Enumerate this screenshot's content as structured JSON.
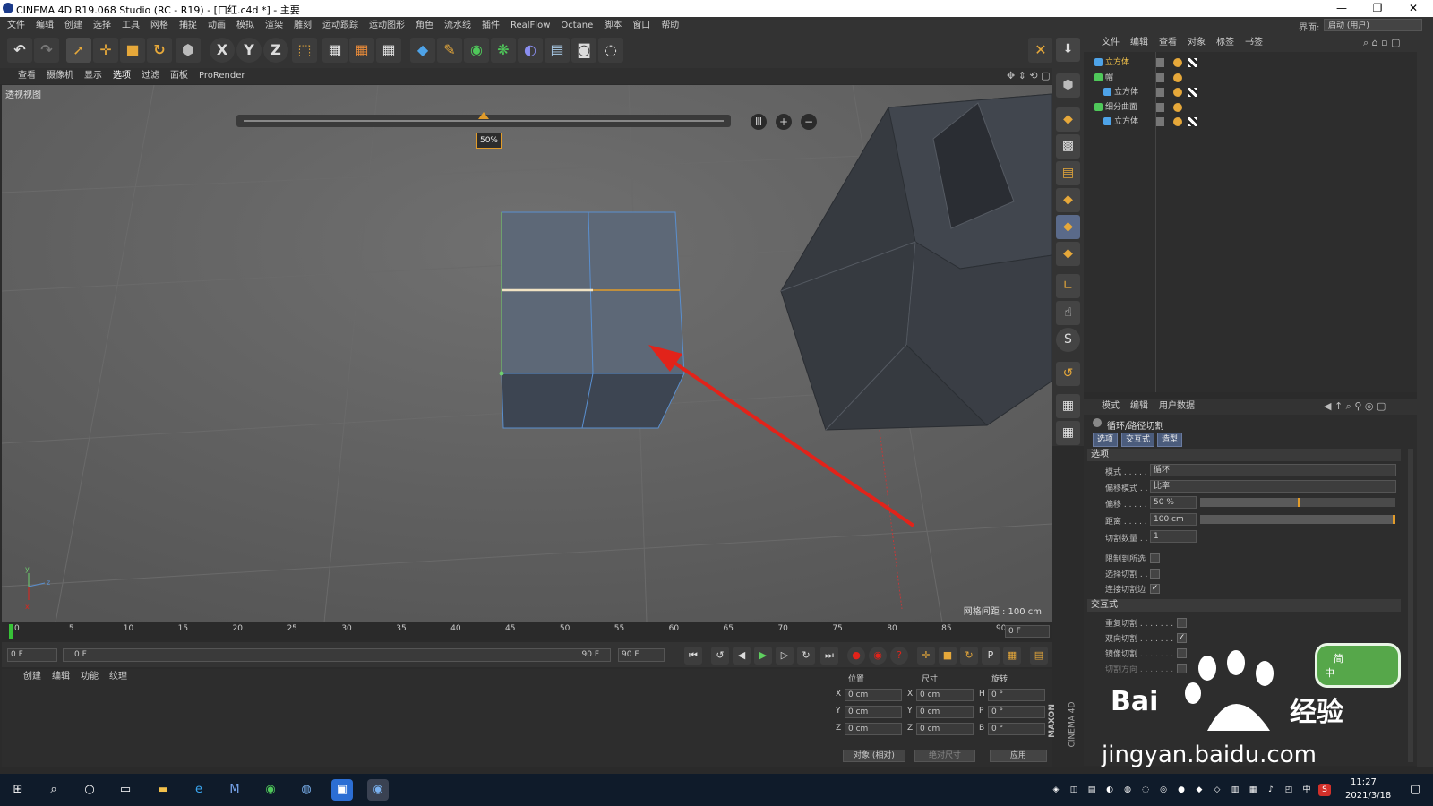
{
  "window": {
    "title": "CINEMA 4D R19.068 Studio (RC - R19) - [口红.c4d *] - 主要",
    "minimize": "—",
    "restore": "❐",
    "close": "✕"
  },
  "menubar": {
    "items": [
      "文件",
      "编辑",
      "创建",
      "选择",
      "工具",
      "网格",
      "捕捉",
      "动画",
      "模拟",
      "渲染",
      "雕刻",
      "运动跟踪",
      "运动图形",
      "角色",
      "流水线",
      "插件",
      "RealFlow",
      "Octane",
      "脚本",
      "窗口",
      "帮助"
    ],
    "layout_label": "界面:",
    "layout_value": "启动 (用户)"
  },
  "toolbar": {
    "axis_x": "X",
    "axis_y": "Y",
    "axis_z": "Z"
  },
  "viewmenu": {
    "items": [
      "查看",
      "摄像机",
      "显示",
      "选项",
      "过滤",
      "面板",
      "ProRender"
    ]
  },
  "viewport": {
    "title": "透视视图",
    "grid_spacing": "网格间距 : 100 cm",
    "slider_value": "50%",
    "slider_fraction": 0.5,
    "btn_pause": "Ⅲ",
    "btn_plus": "+",
    "btn_minus": "−"
  },
  "object_manager": {
    "menu": [
      "文件",
      "编辑",
      "查看",
      "对象",
      "标签",
      "书签"
    ],
    "objects": [
      {
        "name": "立方体",
        "indent": 0
      },
      {
        "name": "帽",
        "indent": 0
      },
      {
        "name": "立方体",
        "indent": 1
      },
      {
        "name": "细分曲面",
        "indent": 0
      },
      {
        "name": "立方体",
        "indent": 1
      }
    ]
  },
  "attribute_manager": {
    "menu": [
      "模式",
      "编辑",
      "用户数据"
    ],
    "title": "循环/路径切割",
    "tabs": [
      "选项",
      "交互式",
      "造型"
    ],
    "section_options": "选项",
    "mode_label": "模式 . . . . .",
    "mode_value": "循环",
    "offset_mode_label": "偏移模式 . .",
    "offset_mode_value": "比率",
    "offset_label": "偏移 . . . . .",
    "offset_value": "50 %",
    "offset_fraction": 0.5,
    "distance_label": "距离 . . . . .",
    "distance_value": "100 cm",
    "distance_fraction": 1.0,
    "cut_count_label": "切割数量 . .",
    "cut_count_value": "1",
    "limit_label": "限制到所选",
    "select_cut_label": "选择切割 . .",
    "connect_label": "连接切割边",
    "connect_checked": "✓",
    "section_interactive": "交互式",
    "repeat_label": "重复切割 . . . . . . .",
    "bidirectional_label": "双向切割 . . . . . . .",
    "bidirectional_checked": "✓",
    "mirror_label": "镜像切割 . . . . . . .",
    "direction_label": "切割方向 . . . . . . ."
  },
  "timeline": {
    "ticks": [
      "0",
      "5",
      "10",
      "15",
      "20",
      "25",
      "30",
      "35",
      "40",
      "45",
      "50",
      "55",
      "60",
      "65",
      "70",
      "75",
      "80",
      "85",
      "90"
    ],
    "end_field": "0 F"
  },
  "transport": {
    "start_field": "0 F",
    "range_start": "0 F",
    "range_end": "90 F",
    "end_field": "90 F"
  },
  "material_manager": {
    "menu": [
      "创建",
      "编辑",
      "功能",
      "纹理"
    ]
  },
  "coord_manager": {
    "header_pos": "位置",
    "header_size": "尺寸",
    "header_rot": "旋转",
    "rows": [
      {
        "axis": "X",
        "pos": "0 cm",
        "size_axis": "X",
        "size": "0 cm",
        "rot_axis": "H",
        "rot": "0 °"
      },
      {
        "axis": "Y",
        "pos": "0 cm",
        "size_axis": "Y",
        "size": "0 cm",
        "rot_axis": "P",
        "rot": "0 °"
      },
      {
        "axis": "Z",
        "pos": "0 cm",
        "size_axis": "Z",
        "size": "0 cm",
        "rot_axis": "B",
        "rot": "0 °"
      }
    ],
    "mode_object": "对象 (相对)",
    "mode_size": "绝对尺寸",
    "apply": "应用"
  },
  "branding": {
    "maxon": "MAXON",
    "cinema": "CINEMA 4D"
  },
  "watermark": {
    "brand": "Bai",
    "jingyan": "经验",
    "url": "jingyan.baidu.com"
  },
  "taskbar": {
    "time": "11:27",
    "date": "2021/3/18",
    "ime": "中"
  },
  "colors": {
    "accent": "#e29c2a",
    "selection_edge": "#f1e3c3",
    "arrow": "#e2231a"
  }
}
